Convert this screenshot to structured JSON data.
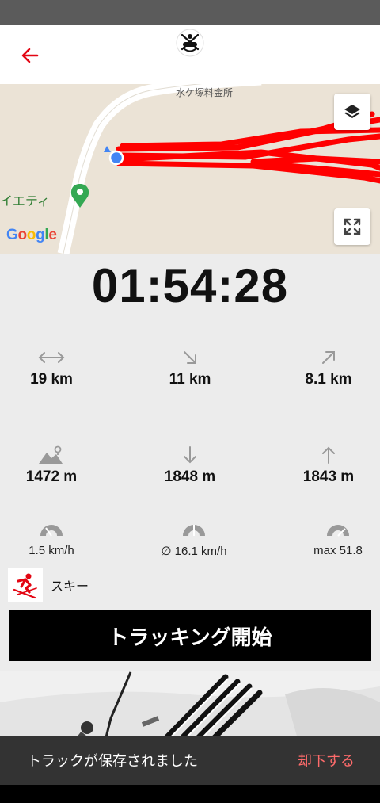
{
  "header": {
    "back_icon": "back-arrow-icon",
    "logo_icon": "skier-logo-icon",
    "accent": "#e30613"
  },
  "map": {
    "road_label": "水ケ塚料金所",
    "poi_label": "イエティ",
    "attribution": "Google",
    "layers_icon": "layers-icon",
    "fullscreen_icon": "fullscreen-icon",
    "track_color": "#ff0000"
  },
  "timer": "01:54:28",
  "stats": [
    {
      "icon": "horizontal-distance-icon",
      "value": "19 km"
    },
    {
      "icon": "downhill-distance-icon",
      "value": "11 km"
    },
    {
      "icon": "uphill-distance-icon",
      "value": "8.1 km"
    },
    {
      "icon": "altitude-icon",
      "value": "1472 m"
    },
    {
      "icon": "descent-icon",
      "value": "1848 m"
    },
    {
      "icon": "ascent-icon",
      "value": "1843 m"
    },
    {
      "icon": "speedometer-icon",
      "value": "1.5 km/h"
    },
    {
      "icon": "avg-speed-icon",
      "value": "∅ 16.1 km/h"
    },
    {
      "icon": "max-speed-icon",
      "value": "max 51.8"
    }
  ],
  "sport": {
    "icon": "ski-icon",
    "label": "スキー"
  },
  "track_button": "トラッキング開始",
  "snackbar": {
    "message": "トラックが保存されました",
    "action": "却下する"
  }
}
